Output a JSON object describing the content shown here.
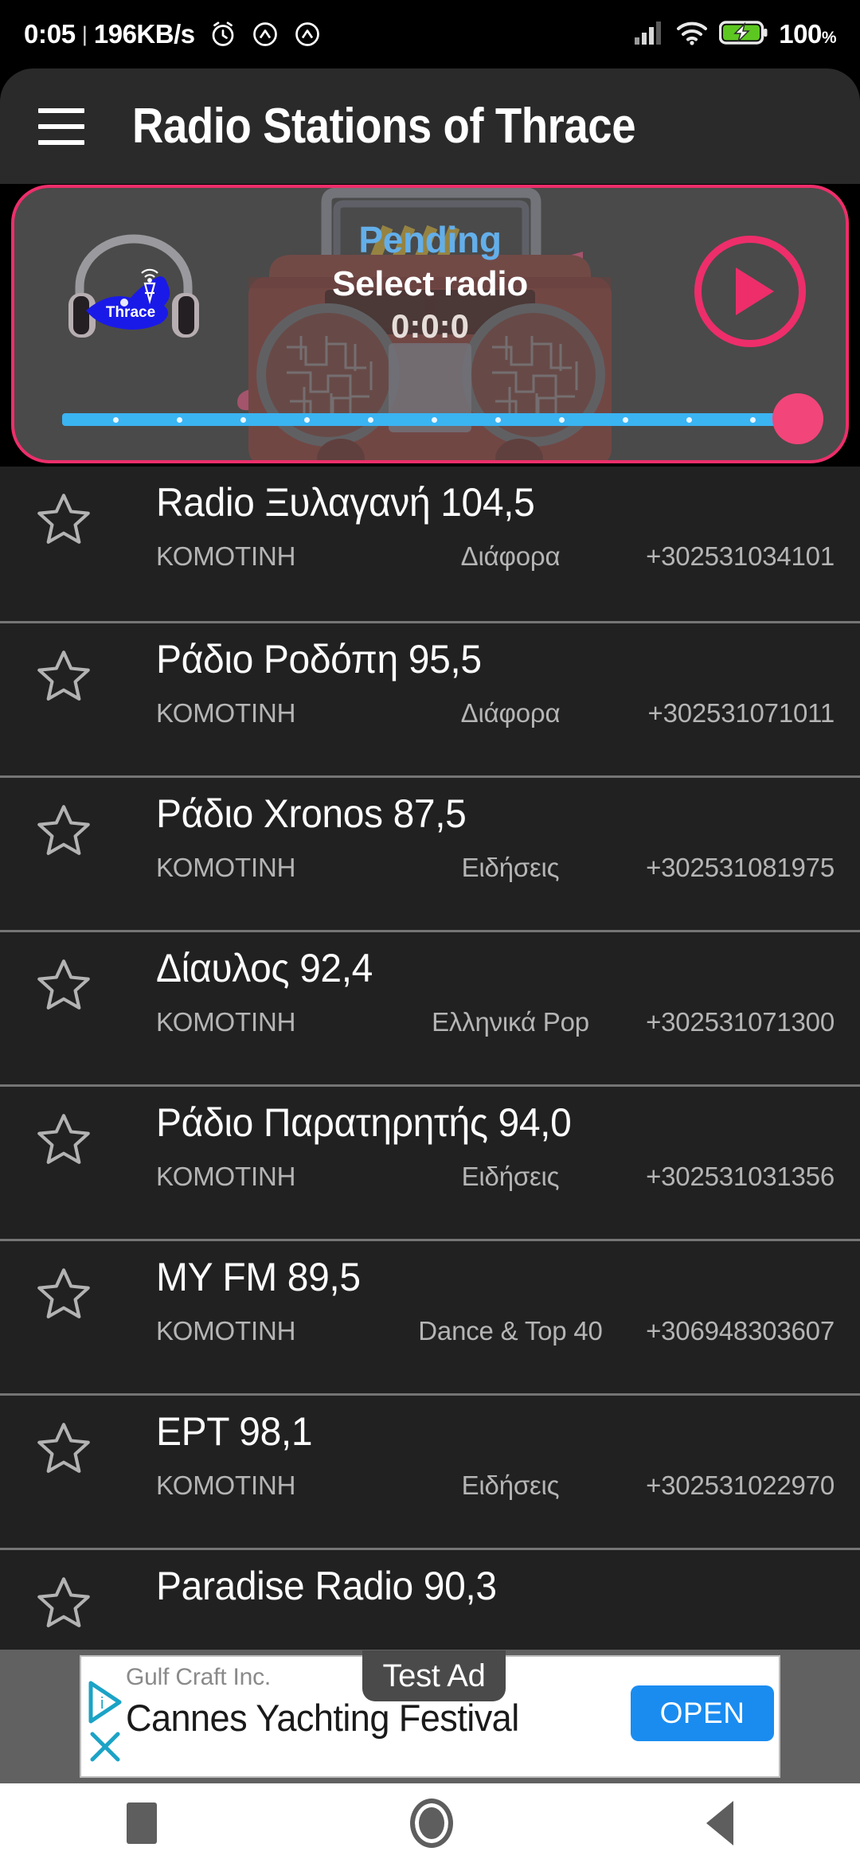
{
  "status_bar": {
    "clock": "0:05",
    "separator": "|",
    "network_speed": "196KB/s",
    "alarm_icon": "alarm-clock-icon",
    "mute_icon_1": "mute-icon",
    "mute_icon_2": "mute-icon",
    "signal_icon": "cellular-signal-icon",
    "wifi_icon": "wifi-icon",
    "battery_icon": "battery-charging-icon",
    "battery_percent": "100",
    "battery_unit": "%",
    "battery_color": "#5DC721"
  },
  "header": {
    "menu_icon": "hamburger-menu-icon",
    "title": "Radio Stations of Thrace",
    "background": "#2a2a2a"
  },
  "player": {
    "accent_color": "#ED2E6B",
    "logo_alt": "Thrace",
    "logo_caption": "Thrace",
    "status": "Pending",
    "status_color": "#63AFEA",
    "station": "Select radio",
    "time": "0:0:0",
    "play_icon": "play-icon",
    "slider": {
      "track_color": "#3BB4F2",
      "thumb_color": "#F2457A",
      "value_percent": 100,
      "ticks": 11
    }
  },
  "list": {
    "star_icon": "star-outline-icon",
    "rows": [
      {
        "name": "Radio Ξυλαγανή 104,5",
        "city": "ΚΟΜΟΤΙΝΗ",
        "genre": "Διάφορα",
        "phone": "+302531034101",
        "favorite": false
      },
      {
        "name": "Ράδιο Ροδόπη 95,5",
        "city": "ΚΟΜΟΤΙΝΗ",
        "genre": "Διάφορα",
        "phone": "+302531071011",
        "favorite": false
      },
      {
        "name": "Ράδιο Xronos 87,5",
        "city": "ΚΟΜΟΤΙΝΗ",
        "genre": "Ειδήσεις",
        "phone": "+302531081975",
        "favorite": false
      },
      {
        "name": "Δίαυλος 92,4",
        "city": "ΚΟΜΟΤΙΝΗ",
        "genre": "Ελληνικά Pop",
        "phone": "+302531071300",
        "favorite": false
      },
      {
        "name": "Ράδιο Παρατηρητής  94,0",
        "city": "ΚΟΜΟΤΙΝΗ",
        "genre": "Ειδήσεις",
        "phone": "+302531031356",
        "favorite": false
      },
      {
        "name": "MY FM 89,5",
        "city": "ΚΟΜΟΤΙΝΗ",
        "genre": "Dance & Top 40",
        "phone": "+306948303607",
        "favorite": false
      },
      {
        "name": "ΕΡΤ 98,1",
        "city": "ΚΟΜΟΤΙΝΗ",
        "genre": "Ειδήσεις",
        "phone": "+302531022970",
        "favorite": false
      },
      {
        "name": "Paradise Radio 90,3",
        "city": "",
        "genre": "",
        "phone": "",
        "favorite": false
      }
    ]
  },
  "ad": {
    "badge": "Test Ad",
    "advertiser": "Gulf Craft Inc.",
    "title": "Cannes Yachting Festival",
    "cta": "OPEN",
    "cta_color": "#1a8cf0",
    "adchoices_icon": "adchoices-icon",
    "close_icon": "close-icon"
  },
  "navbar": {
    "recents_icon": "recents-square-icon",
    "home_icon": "home-circle-icon",
    "back_icon": "back-triangle-icon"
  }
}
